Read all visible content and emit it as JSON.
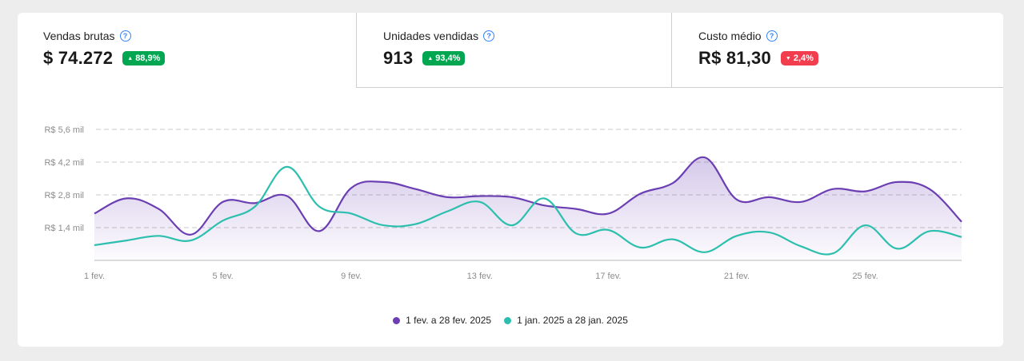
{
  "kpis": [
    {
      "title": "Vendas brutas",
      "value": "$ 74.272",
      "change": "88,9%",
      "direction": "up"
    },
    {
      "title": "Unidades vendidas",
      "value": "913",
      "change": "93,4%",
      "direction": "up"
    },
    {
      "title": "Custo médio",
      "value": "R$ 81,30",
      "change": "2,4%",
      "direction": "down"
    }
  ],
  "icons": {
    "help": "help-circle-icon",
    "up": "caret-up-icon",
    "down": "caret-down-icon"
  },
  "colors": {
    "current": "#6b3fb3",
    "previous": "#2cbfae",
    "up": "#00a650",
    "down": "#f23d4f"
  },
  "chart_data": {
    "type": "area",
    "x": [
      "1 fev.",
      "2 fev.",
      "3 fev.",
      "4 fev.",
      "5 fev.",
      "6 fev.",
      "7 fev.",
      "8 fev.",
      "9 fev.",
      "10 fev.",
      "11 fev.",
      "12 fev.",
      "13 fev.",
      "14 fev.",
      "15 fev.",
      "16 fev.",
      "17 fev.",
      "18 fev.",
      "19 fev.",
      "20 fev.",
      "21 fev.",
      "22 fev.",
      "23 fev.",
      "24 fev.",
      "25 fev.",
      "26 fev.",
      "27 fev.",
      "28 fev."
    ],
    "xticks": [
      "1 fev.",
      "5 fev.",
      "9 fev.",
      "13 fev.",
      "17 fev.",
      "21 fev.",
      "25 fev."
    ],
    "ylim": [
      0,
      5.6
    ],
    "yticks": [
      1.4,
      2.8,
      4.2,
      5.6
    ],
    "ytick_labels": [
      "R$ 1,4 mil",
      "R$ 2,8 mil",
      "R$ 4,2 mil",
      "R$ 5,6 mil"
    ],
    "grid": true,
    "legend_position": "bottom",
    "series": [
      {
        "name": "1 fev. a 28 fev. 2025",
        "fill": true,
        "values": [
          2.0,
          2.65,
          2.2,
          1.1,
          2.5,
          2.45,
          2.75,
          1.25,
          3.1,
          3.35,
          3.05,
          2.7,
          2.75,
          2.7,
          2.35,
          2.2,
          2.0,
          2.85,
          3.3,
          4.4,
          2.6,
          2.7,
          2.5,
          3.05,
          2.95,
          3.35,
          3.05,
          1.65
        ]
      },
      {
        "name": "1 jan. 2025 a 28 jan. 2025",
        "fill": false,
        "values": [
          0.65,
          0.85,
          1.05,
          0.85,
          1.7,
          2.3,
          4.0,
          2.3,
          2.0,
          1.5,
          1.55,
          2.1,
          2.5,
          1.5,
          2.65,
          1.15,
          1.3,
          0.55,
          0.9,
          0.35,
          1.05,
          1.2,
          0.6,
          0.3,
          1.5,
          0.5,
          1.25,
          1.0
        ]
      }
    ]
  }
}
